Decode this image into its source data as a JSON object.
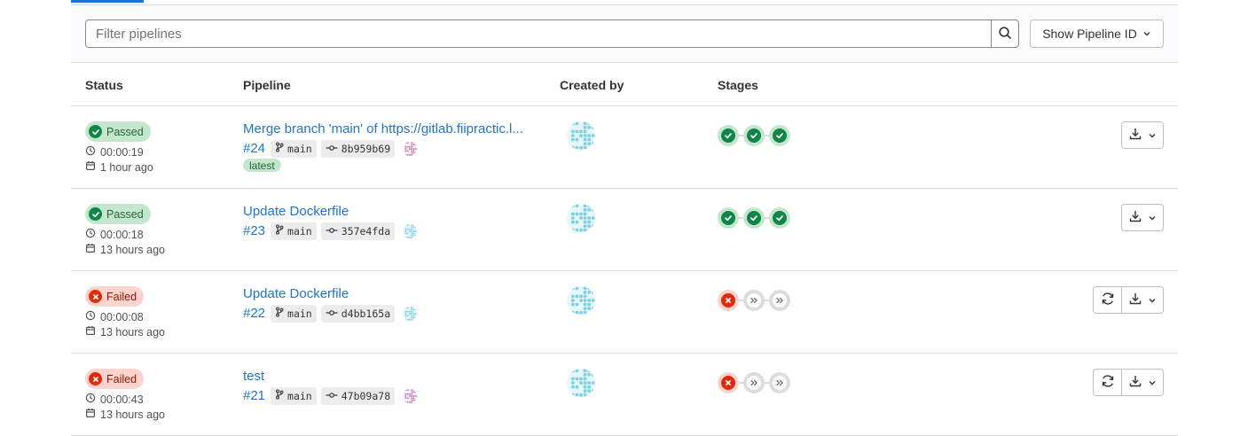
{
  "filter": {
    "placeholder": "Filter pipelines",
    "dropdown_label": "Show Pipeline ID"
  },
  "columns": {
    "status": "Status",
    "pipeline": "Pipeline",
    "created_by": "Created by",
    "stages": "Stages"
  },
  "colors": {
    "link": "#1f75cb",
    "success": "#108548",
    "failed": "#dd2b0e"
  },
  "pipelines": [
    {
      "status": "Passed",
      "duration": "00:00:19",
      "created": "1 hour ago",
      "title": "Merge branch 'main' of https://gitlab.fiipractic.l...",
      "id": "#24",
      "branch": "main",
      "commit": "8b959b69",
      "latest": "latest",
      "stages": [
        "success",
        "success",
        "success"
      ],
      "retry": false
    },
    {
      "status": "Passed",
      "duration": "00:00:18",
      "created": "13 hours ago",
      "title": "Update Dockerfile",
      "id": "#23",
      "branch": "main",
      "commit": "357e4fda",
      "stages": [
        "success",
        "success",
        "success"
      ],
      "retry": false
    },
    {
      "status": "Failed",
      "duration": "00:00:08",
      "created": "13 hours ago",
      "title": "Update Dockerfile",
      "id": "#22",
      "branch": "main",
      "commit": "d4bb165a",
      "stages": [
        "failed",
        "skipped",
        "skipped"
      ],
      "retry": true
    },
    {
      "status": "Failed",
      "duration": "00:00:43",
      "created": "13 hours ago",
      "title": "test",
      "id": "#21",
      "branch": "main",
      "commit": "47b09a78",
      "stages": [
        "failed",
        "skipped",
        "skipped"
      ],
      "retry": true
    }
  ]
}
